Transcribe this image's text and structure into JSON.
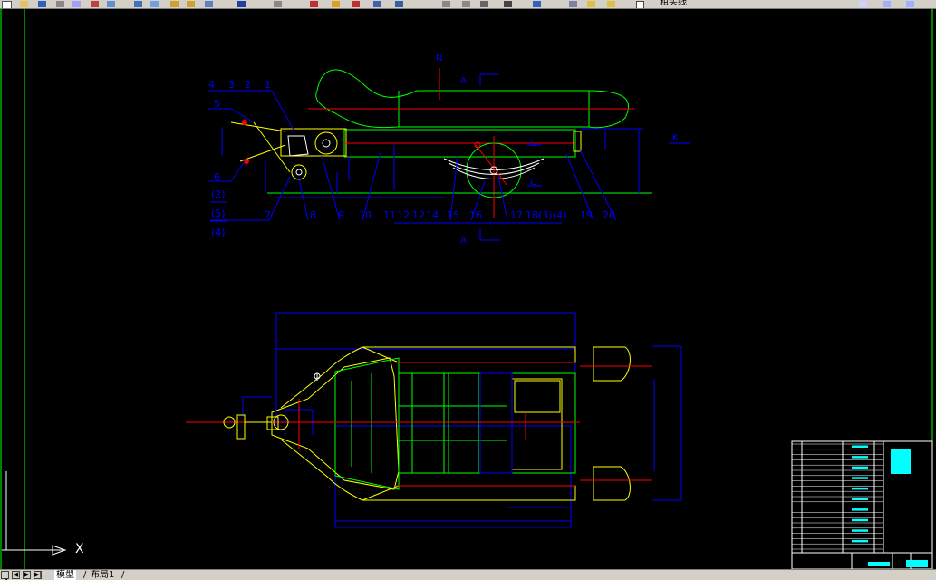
{
  "toolbar": {
    "layer_name": "粗实线",
    "icons": [
      "new-icon",
      "open-icon",
      "save-icon",
      "print-icon",
      "preview-icon",
      "cut-icon",
      "copy-icon",
      "paste-icon",
      "match-icon",
      "undo-icon",
      "redo-icon",
      "pan-icon",
      "zoom-realtime-icon",
      "zoom-window-icon",
      "zoom-previous-icon",
      "properties-icon",
      "design-center-icon",
      "tool-palette-icon",
      "sheet-set-icon",
      "markup-icon",
      "calc-icon",
      "help-icon",
      "layer-manager-icon",
      "layer-state-icon"
    ]
  },
  "drawing": {
    "side_view_labels": {
      "top_row": [
        "4",
        "3",
        "2",
        "1"
      ],
      "left": [
        "5",
        "6",
        "(2)",
        "(5)",
        "(4)"
      ],
      "bottom_row": [
        "7",
        "8",
        "9",
        "10",
        "11",
        "12",
        "12",
        "14",
        "15",
        "16",
        "17",
        "18",
        "(3)",
        "(4)",
        "19",
        "20"
      ],
      "section_marks": [
        "N",
        "A",
        "A",
        "K",
        "C",
        "C"
      ]
    }
  },
  "ucs": {
    "x_label": "X"
  },
  "tabs": {
    "model_label": "模型",
    "layout_label": "布局1",
    "separator": "/",
    "nav": [
      "|◀",
      "◀",
      "▶",
      "▶|"
    ]
  },
  "colors": {
    "background": "#000000",
    "outline": "#ffff00",
    "hull": "#00ff00",
    "centerline": "#ff0000",
    "dimension": "#0000ff",
    "label": "#0000ff",
    "white": "#ffffff",
    "cyan": "#00ffff"
  }
}
